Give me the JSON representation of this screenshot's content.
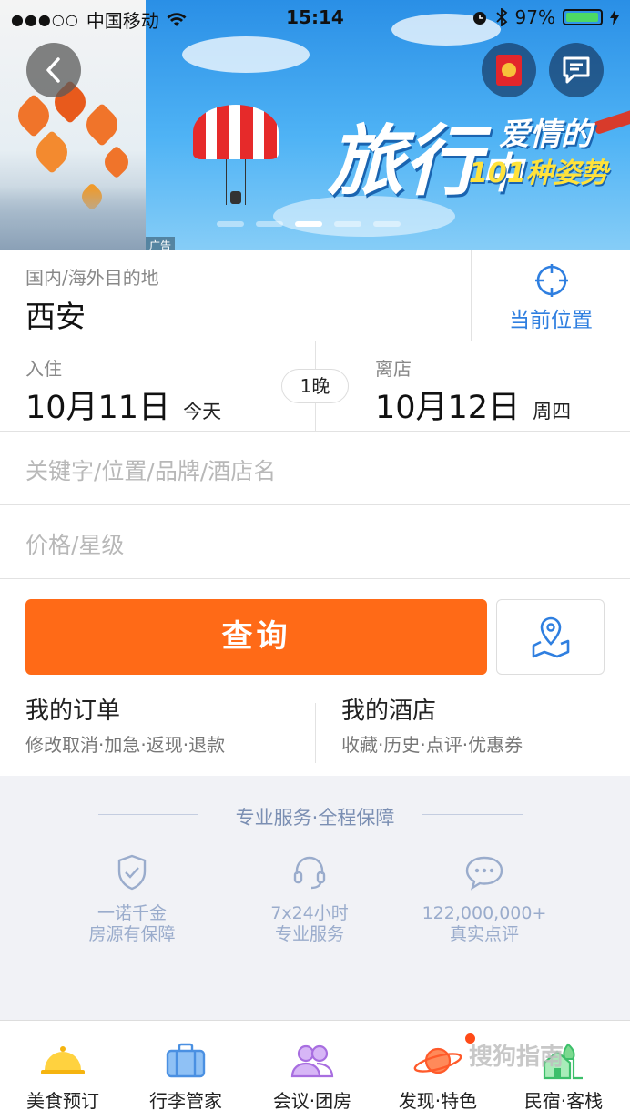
{
  "status_bar": {
    "signal": "●●●○○",
    "carrier": "中国移动",
    "time": "15:14",
    "battery": "97%",
    "battery_level": 0.97
  },
  "banner": {
    "ad_title_main": "旅行",
    "ad_title_mid": "中",
    "ad_title_sub": "爱情的",
    "ad_title_sub2": "101种姿势",
    "ad_tag": "广告",
    "page_count": 5,
    "active_page": 3
  },
  "destination": {
    "label": "国内/海外目的地",
    "value": "西安",
    "location_label": "当前位置"
  },
  "dates": {
    "checkin_label": "入住",
    "checkin_date": "10月11日",
    "checkin_day": "今天",
    "nights": "1晚",
    "checkout_label": "离店",
    "checkout_date": "10月12日",
    "checkout_day": "周四"
  },
  "keyword": {
    "placeholder": "关键字/位置/品牌/酒店名"
  },
  "price": {
    "placeholder": "价格/星级"
  },
  "search_label": "查询",
  "links": {
    "orders_title": "我的订单",
    "orders_sub": "修改取消·加急·返现·退款",
    "hotels_title": "我的酒店",
    "hotels_sub": "收藏·历史·点评·优惠券"
  },
  "services": {
    "heading": "专业服务·全程保障",
    "items": [
      {
        "line1": "一诺千金",
        "line2": "房源有保障",
        "icon": "shield-icon"
      },
      {
        "line1": "7x24小时",
        "line2": "专业服务",
        "icon": "headset-icon"
      },
      {
        "line1": "122,000,000+",
        "line2": "真实点评",
        "icon": "chat-bubble-icon"
      }
    ]
  },
  "tabs": [
    {
      "label": "美食预订",
      "icon": "food-cloche-icon",
      "color": "#f5b40f"
    },
    {
      "label": "行李管家",
      "icon": "luggage-icon",
      "color": "#4a90e2"
    },
    {
      "label": "会议·团房",
      "icon": "group-people-icon",
      "color": "#a86ee0"
    },
    {
      "label": "发现·特色",
      "icon": "planet-icon",
      "color": "#ff5a2a"
    },
    {
      "label": "民宿·客栈",
      "icon": "house-tree-icon",
      "color": "#3cbf6a"
    }
  ],
  "watermark": "搜狗指南",
  "colors": {
    "primary_orange": "#ff6a17",
    "accent_blue": "#2f7fe0",
    "service_text": "#9aaccc"
  }
}
